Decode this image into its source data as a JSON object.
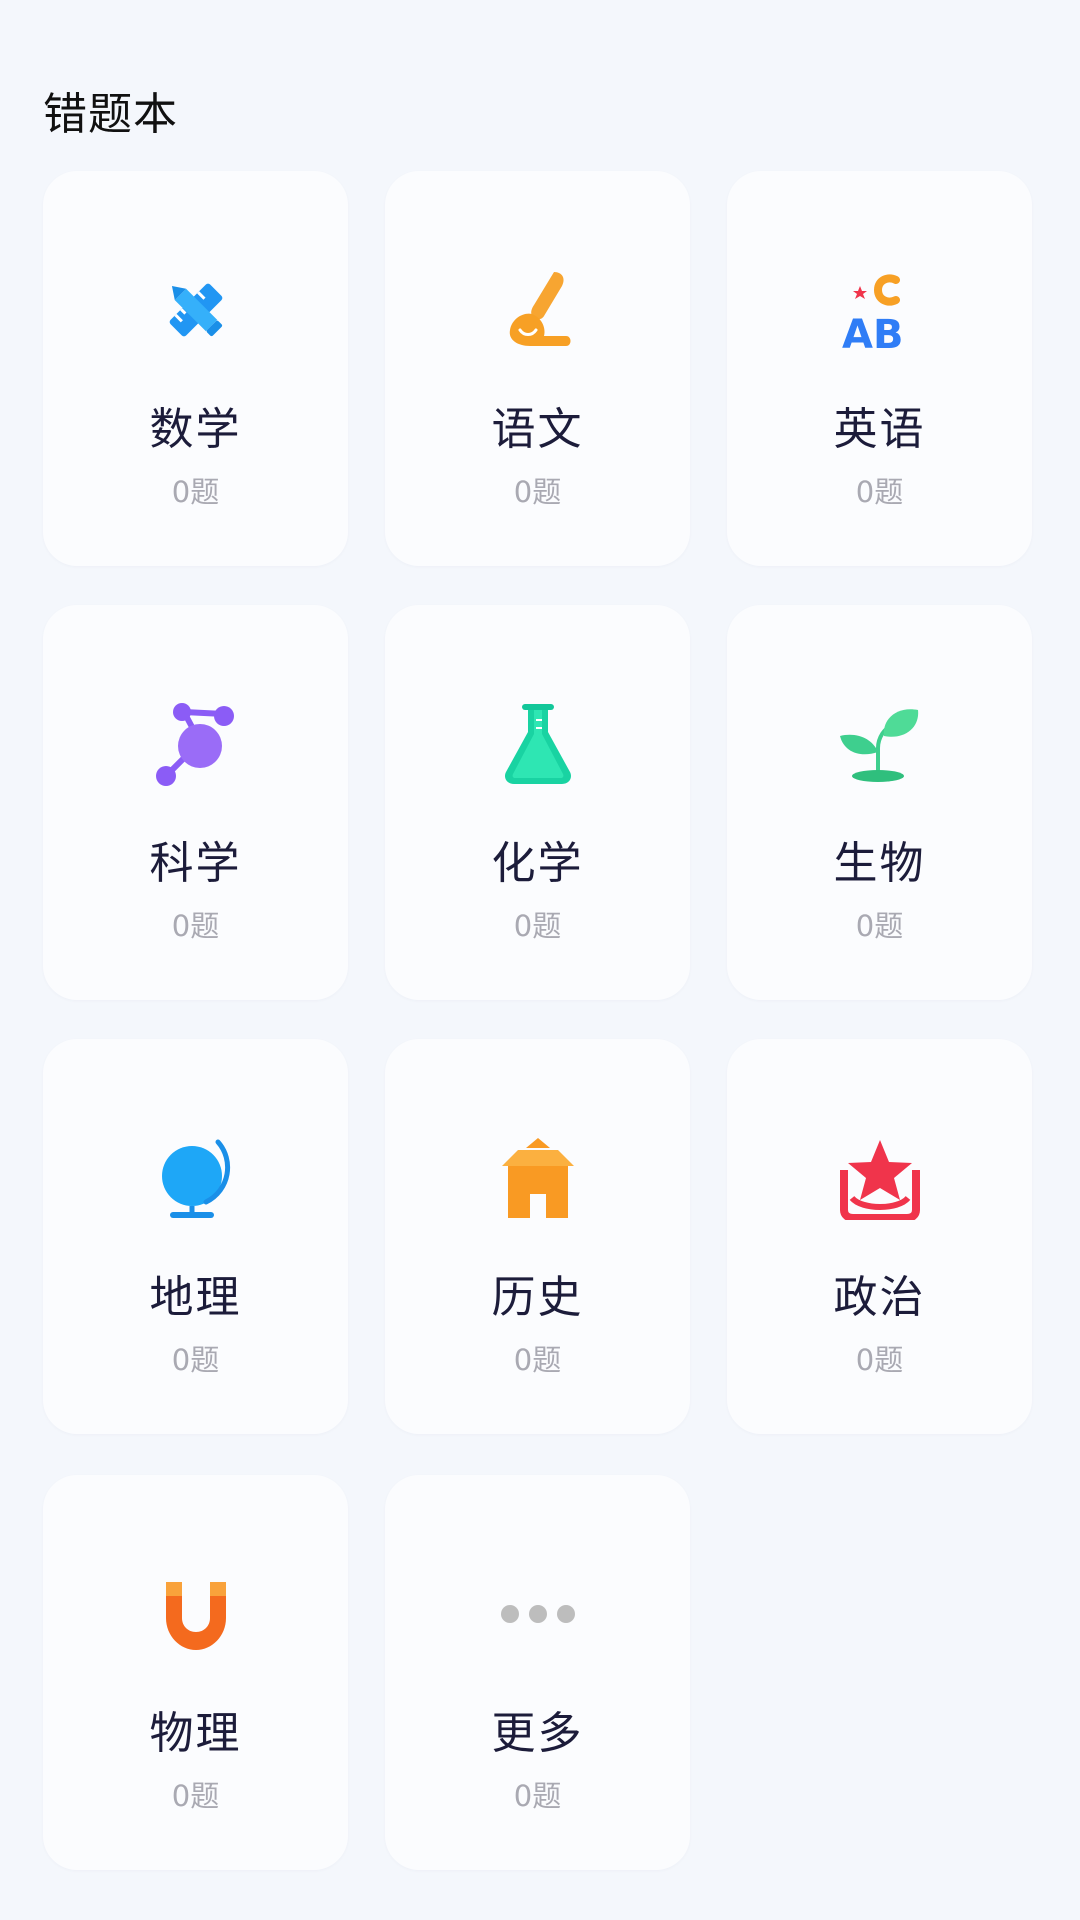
{
  "header": {
    "title": "错题本"
  },
  "subjects": [
    {
      "name": "数学",
      "count": "0题",
      "icon": "math-ruler-pencil-icon",
      "color": "#2196f3"
    },
    {
      "name": "语文",
      "count": "0题",
      "icon": "brush-icon",
      "color": "#f7a025"
    },
    {
      "name": "英语",
      "count": "0题",
      "icon": "abc-letters-icon",
      "color": "#2f7df6"
    },
    {
      "name": "科学",
      "count": "0题",
      "icon": "molecule-icon",
      "color": "#8b5cf6"
    },
    {
      "name": "化学",
      "count": "0题",
      "icon": "flask-icon",
      "color": "#19d3a2"
    },
    {
      "name": "生物",
      "count": "0题",
      "icon": "sprout-icon",
      "color": "#3ecf8e"
    },
    {
      "name": "地理",
      "count": "0题",
      "icon": "globe-icon",
      "color": "#1ea7f7"
    },
    {
      "name": "历史",
      "count": "0题",
      "icon": "pavilion-icon",
      "color": "#f99a23"
    },
    {
      "name": "政治",
      "count": "0题",
      "icon": "star-badge-icon",
      "color": "#f0344b"
    },
    {
      "name": "物理",
      "count": "0题",
      "icon": "magnet-icon",
      "color": "#f46a1e"
    },
    {
      "name": "更多",
      "count": "0题",
      "icon": "more-dots-icon",
      "color": "#bdbdbd"
    }
  ]
}
